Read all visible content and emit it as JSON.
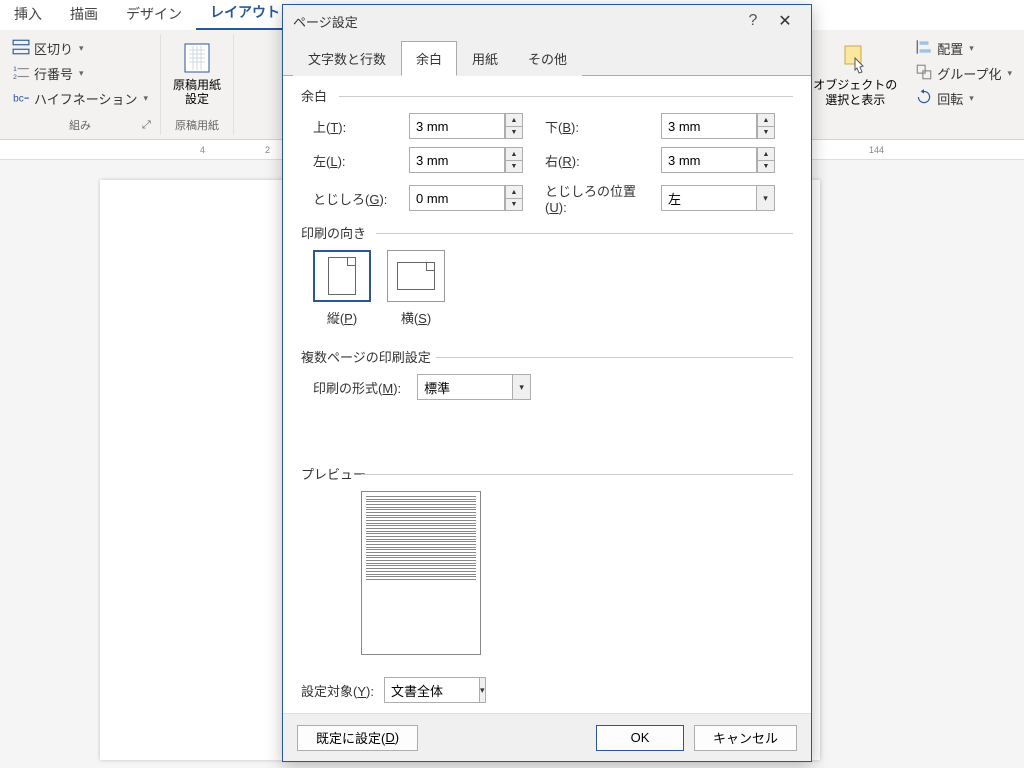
{
  "ribbon": {
    "tabs": {
      "insert": "挿入",
      "draw": "描画",
      "design": "デザイン",
      "layout": "レイアウト"
    },
    "breaks": "区切り",
    "line_numbers": "行番号",
    "hyphenation": "ハイフネーション",
    "group1": "組み",
    "manuscript": {
      "btn": "原稿用紙\n設定",
      "group": "原稿用紙"
    },
    "arrange": {
      "selection": "オブジェクトの\n選択と表示",
      "align": "配置",
      "group": "グループ化",
      "rotate": "回転"
    }
  },
  "ruler": {
    "m1": "4",
    "m2": "2",
    "m3": "144"
  },
  "dialog": {
    "title": "ページ設定",
    "tabs": {
      "chars": "文字数と行数",
      "margins": "余白",
      "paper": "用紙",
      "other": "その他"
    },
    "margins": {
      "legend": "余白",
      "top_label": "上(T):",
      "top_val": "3 mm",
      "bottom_label": "下(B):",
      "bottom_val": "3 mm",
      "left_label": "左(L):",
      "left_val": "3 mm",
      "right_label": "右(R):",
      "right_val": "3 mm",
      "gutter_label": "とじしろ(G):",
      "gutter_val": "0 mm",
      "gutter_pos_label": "とじしろの位置(U):",
      "gutter_pos_val": "左"
    },
    "orientation": {
      "legend": "印刷の向き",
      "portrait": "縦(P)",
      "landscape": "横(S)"
    },
    "multi": {
      "legend": "複数ページの印刷設定",
      "format_label": "印刷の形式(M):",
      "format_val": "標準"
    },
    "preview": {
      "legend": "プレビュー"
    },
    "apply": {
      "label": "設定対象(Y):",
      "val": "文書全体"
    },
    "footer": {
      "default": "既定に設定(D)",
      "ok": "OK",
      "cancel": "キャンセル"
    }
  }
}
